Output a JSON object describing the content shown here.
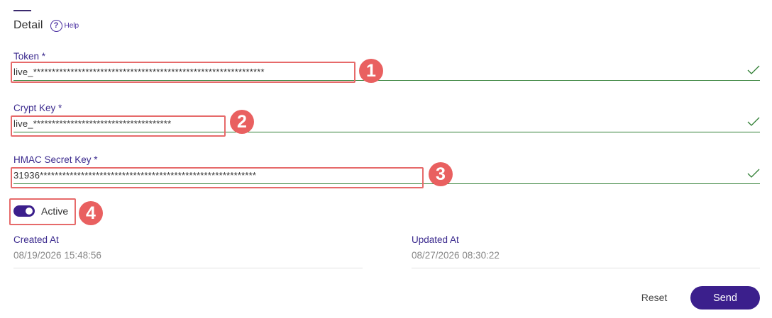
{
  "header": {
    "title": "Detail",
    "help_label": "Help",
    "help_icon": "question-circle-icon"
  },
  "fields": {
    "token": {
      "label": "Token *",
      "value": "live_**************************************************************"
    },
    "crypt_key": {
      "label": "Crypt Key *",
      "value": "live_*************************************"
    },
    "hmac_secret_key": {
      "label": "HMAC Secret Key *",
      "value": "31936**********************************************************"
    }
  },
  "active_toggle": {
    "label": "Active",
    "checked": true
  },
  "meta": {
    "created_at": {
      "label": "Created At",
      "value": "08/19/2026 15:48:56"
    },
    "updated_at": {
      "label": "Updated At",
      "value": "08/27/2026 08:30:22"
    }
  },
  "actions": {
    "reset_label": "Reset",
    "send_label": "Send"
  },
  "annotations": {
    "badge_1": "1",
    "badge_2": "2",
    "badge_3": "3",
    "badge_4": "4"
  },
  "colors": {
    "accent": "#3b1f8c",
    "label": "#3b2a8e",
    "valid": "#2e7d32",
    "annotation": "#e96060"
  }
}
